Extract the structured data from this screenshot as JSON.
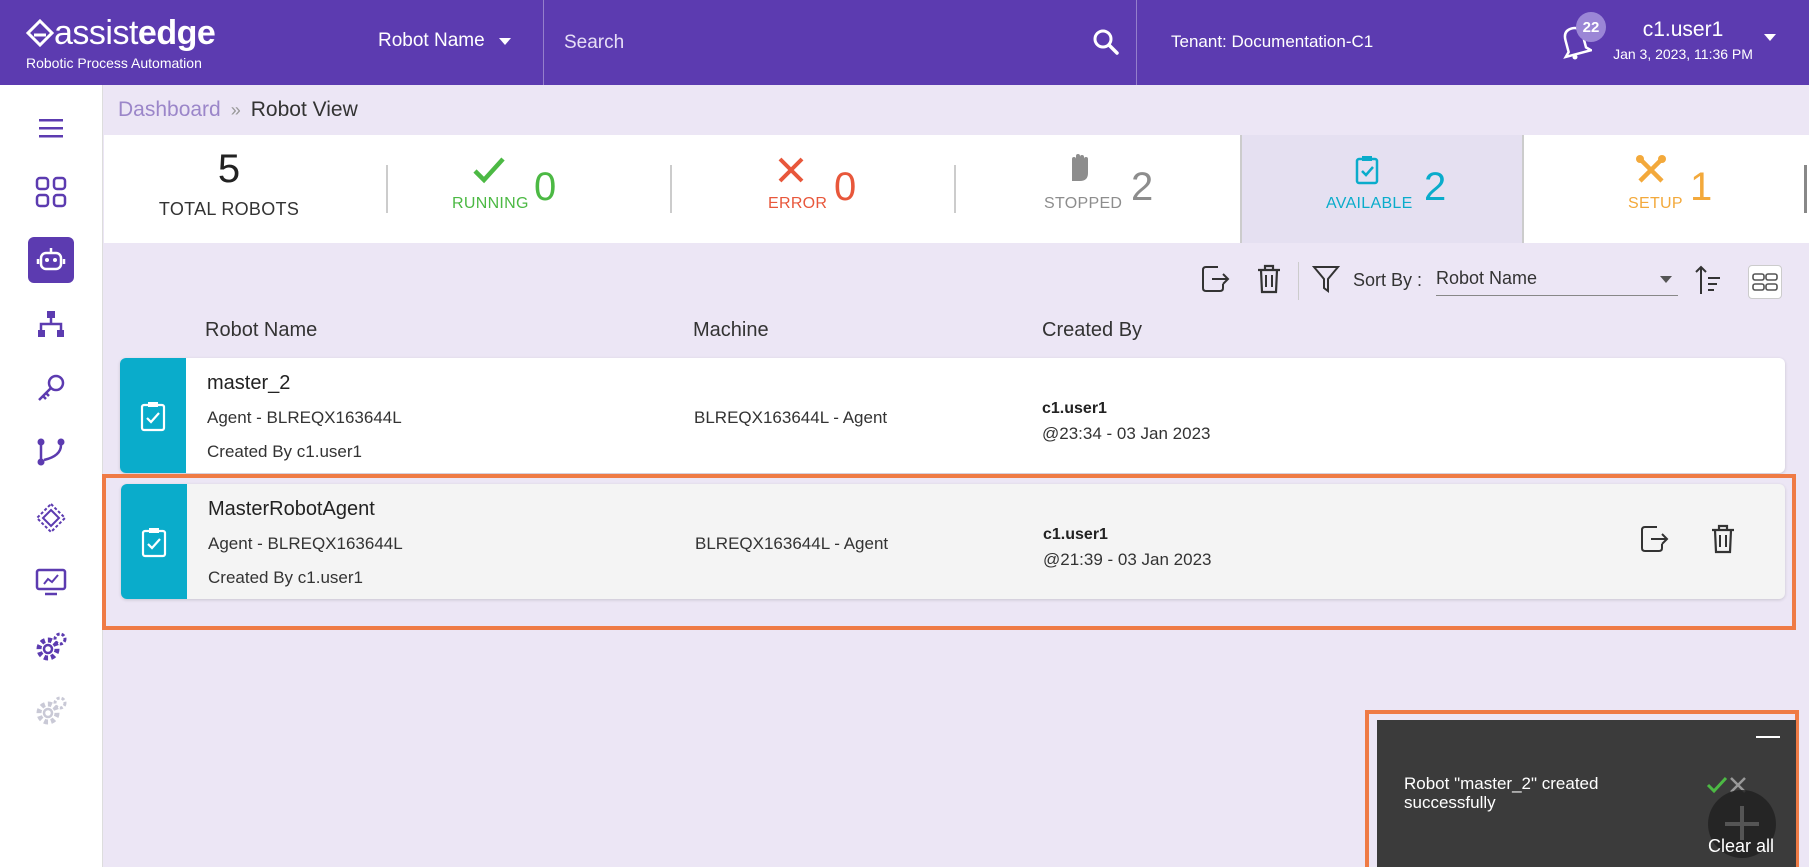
{
  "header": {
    "logo_main_thin": "assist",
    "logo_main_bold": "edge",
    "logo_sub": "Robotic Process Automation",
    "robot_select": "Robot Name",
    "search_placeholder": "Search",
    "tenant_label": "Tenant:",
    "tenant_value": "Documentation-C1",
    "notification_count": "22",
    "user_name": "c1.user1",
    "user_date": "Jan 3, 2023, 11:36 PM"
  },
  "sidebar": {
    "items": [
      {
        "name": "menu-icon"
      },
      {
        "name": "dashboard-icon"
      },
      {
        "name": "robot-icon",
        "active": true
      },
      {
        "name": "hierarchy-icon"
      },
      {
        "name": "key-icon"
      },
      {
        "name": "workflow-icon"
      },
      {
        "name": "chip-icon"
      },
      {
        "name": "monitor-chart-icon"
      },
      {
        "name": "settings-icon"
      },
      {
        "name": "settings-disabled-icon"
      }
    ]
  },
  "breadcrumb": {
    "parent": "Dashboard",
    "current": "Robot View"
  },
  "stats": {
    "total": {
      "value": "5",
      "label": "TOTAL ROBOTS"
    },
    "running": {
      "value": "0",
      "label": "RUNNING",
      "color": "#4cb944"
    },
    "error": {
      "value": "0",
      "label": "ERROR",
      "color": "#e8573b"
    },
    "stopped": {
      "value": "2",
      "label": "STOPPED",
      "color": "#8d8d8d"
    },
    "available": {
      "value": "2",
      "label": "AVAILABLE",
      "color": "#0aaccb"
    },
    "setup": {
      "value": "1",
      "label": "SETUP",
      "color": "#f3a93b"
    }
  },
  "toolbar": {
    "sort_label": "Sort By :",
    "sort_value": "Robot Name"
  },
  "table": {
    "headers": [
      "Robot Name",
      "Machine",
      "Created By"
    ],
    "rows": [
      {
        "name": "master_2",
        "agent": "Agent - BLREQX163644L",
        "created": "Created By c1.user1",
        "machine": "BLREQX163644L - Agent",
        "user": "c1.user1",
        "time": "@23:34 - 03 Jan 2023"
      },
      {
        "name": "MasterRobotAgent",
        "agent": "Agent - BLREQX163644L",
        "created": "Created By c1.user1",
        "machine": "BLREQX163644L - Agent",
        "user": "c1.user1",
        "time": "@21:39 - 03 Jan 2023"
      }
    ]
  },
  "toast": {
    "message": "Robot \"master_2\" created successfully",
    "clear_all": "Clear all"
  },
  "colors": {
    "brand": "#5c3bb0",
    "highlight": "#ef7b45",
    "strip": "#0aaccb"
  }
}
